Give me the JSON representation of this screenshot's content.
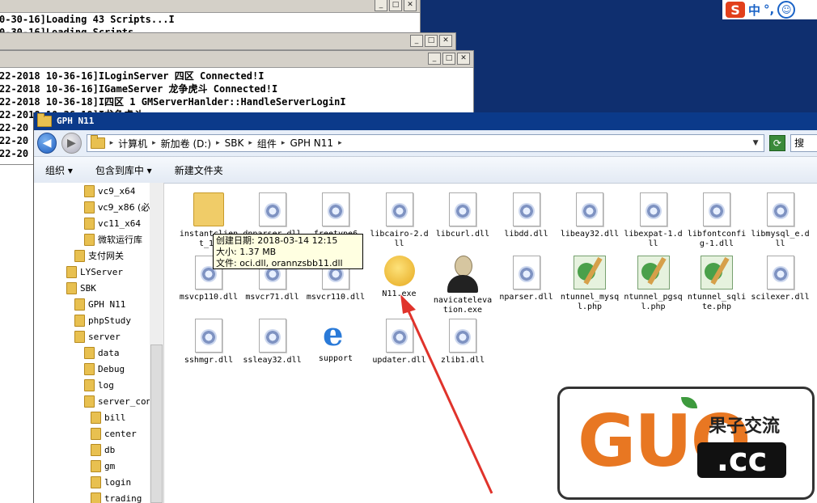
{
  "ime": {
    "logo": "S",
    "lang": "中",
    "punct": "°,",
    "face": "☺"
  },
  "console1": {
    "lines": [
      "0-30-16]Loading 43 Scripts...I",
      "0-30-16]Loading Scripts ..."
    ]
  },
  "console3": {
    "lines": [
      "22-2018 10-36-16]ILoginServer 四区 Connected!I",
      "22-2018 10-36-16]IGameServer 龙争虎斗 Connected!I",
      "22-2018 10-36-18]I四区 1 GMServerHanlder::HandleServerLoginI",
      "22-2018 10-36-18]I龙争虎斗 ...",
      "22-20",
      "22-20",
      "22-20"
    ]
  },
  "window_buttons": {
    "min": "_",
    "max": "□",
    "close": "✕"
  },
  "explorer": {
    "title": "GPH N11",
    "breadcrumbs": [
      "计算机",
      "新加卷 (D:)",
      "SBK",
      "组件",
      "GPH N11"
    ],
    "search_text": "搜",
    "toolbar": {
      "organize": "组织 ▾",
      "include": "包含到库中 ▾",
      "new_folder": "新建文件夹"
    },
    "tree": [
      {
        "label": "vc9_x64",
        "depth": 2
      },
      {
        "label": "vc9_x86 (必",
        "depth": 2
      },
      {
        "label": "vc11_x64",
        "depth": 2
      },
      {
        "label": "微软运行库",
        "depth": 2
      },
      {
        "label": "支付网关",
        "depth": 1
      },
      {
        "label": "LYServer",
        "depth": 0
      },
      {
        "label": "SBK",
        "depth": 0
      },
      {
        "label": "GPH N11",
        "depth": 1
      },
      {
        "label": "phpStudy",
        "depth": 1
      },
      {
        "label": "server",
        "depth": 1
      },
      {
        "label": "data",
        "depth": 2
      },
      {
        "label": "Debug",
        "depth": 2
      },
      {
        "label": "log",
        "depth": 2
      },
      {
        "label": "server_con",
        "depth": 2
      },
      {
        "label": "bill",
        "depth": 3
      },
      {
        "label": "center",
        "depth": 3
      },
      {
        "label": "db",
        "depth": 3
      },
      {
        "label": "gm",
        "depth": 3
      },
      {
        "label": "login",
        "depth": 3
      },
      {
        "label": "trading",
        "depth": 3
      }
    ],
    "files": [
      {
        "name": "instantclient_10",
        "icon": "folder"
      },
      {
        "name": "dnparser.dll",
        "icon": "dll"
      },
      {
        "name": "freetype6",
        "icon": "dll"
      },
      {
        "name": "libcairo-2.dll",
        "icon": "dll"
      },
      {
        "name": "libcurl.dll",
        "icon": "dll"
      },
      {
        "name": "libdd.dll",
        "icon": "dll"
      },
      {
        "name": "libeay32.dll",
        "icon": "dll"
      },
      {
        "name": "libexpat-1.dll",
        "icon": "dll"
      },
      {
        "name": "libfontconfig-1.dll",
        "icon": "dll"
      },
      {
        "name": "libmysql_e.dll",
        "icon": "dll"
      },
      {
        "name": "msvcp110.dll",
        "icon": "dll"
      },
      {
        "name": "msvcr71.dll",
        "icon": "dll"
      },
      {
        "name": "msvcr110.dll",
        "icon": "dll"
      },
      {
        "name": "N11.exe",
        "icon": "n11-exe"
      },
      {
        "name": "navicatelevation.exe",
        "icon": "navicat-exe"
      },
      {
        "name": "nparser.dll",
        "icon": "dll"
      },
      {
        "name": "ntunnel_mysql.php",
        "icon": "php"
      },
      {
        "name": "ntunnel_pgsql.php",
        "icon": "php"
      },
      {
        "name": "ntunnel_sqlite.php",
        "icon": "php"
      },
      {
        "name": "scilexer.dll",
        "icon": "dll"
      },
      {
        "name": "sshmgr.dll",
        "icon": "dll"
      },
      {
        "name": "ssleay32.dll",
        "icon": "dll"
      },
      {
        "name": "support",
        "icon": "ie-shortcut"
      },
      {
        "name": "updater.dll",
        "icon": "dll"
      },
      {
        "name": "zlib1.dll",
        "icon": "dll"
      }
    ],
    "tooltip": {
      "date": "创建日期: 2018-03-14 12:15",
      "size": "大小: 1.37 MB",
      "files": "文件: oci.dll, orannzsbb11.dll"
    }
  },
  "arrow_color": "#e0332b",
  "watermark": {
    "logo": "GUO",
    "domain": ".cc",
    "name": "果子交流"
  }
}
